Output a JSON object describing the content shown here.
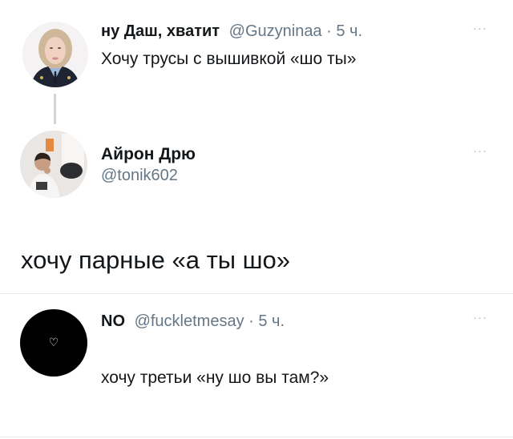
{
  "tweets": [
    {
      "display_name": "ну Даш, хватит",
      "handle": "@Guzyninaa",
      "separator": "·",
      "time": "5 ч.",
      "text": "Хочу трусы с вышивкой «шо ты»",
      "more_icon": "more-dots-icon"
    },
    {
      "display_name": "Айрон Дрю",
      "handle": "@tonik602",
      "text": "хочу парные «а ты шо»",
      "more_icon": "more-dots-icon"
    },
    {
      "display_name": "NO",
      "handle": "@fuckletmesay",
      "separator": "·",
      "time": "5 ч.",
      "text": "хочу третьи «ну шо вы там?»",
      "avatar_icon": "heart-outline-icon",
      "more_icon": "more-dots-icon"
    }
  ],
  "ui": {
    "more_glyph": "···",
    "heart_glyph": "♡"
  },
  "colors": {
    "text_primary": "#14171a",
    "text_secondary": "#657786",
    "divider": "#e6ecf0",
    "thread_line": "#ccd6dd",
    "avatar_black": "#000000"
  }
}
